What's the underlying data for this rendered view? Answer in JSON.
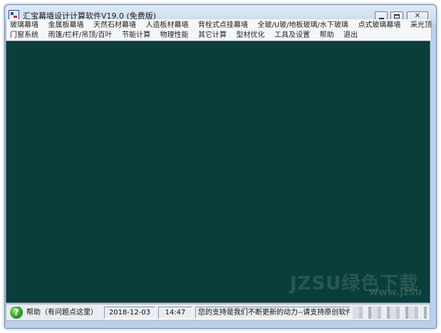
{
  "window": {
    "title": "汇宝幕墙设计计算软件V19.0 (免费版)"
  },
  "menu": {
    "row1": [
      "玻璃幕墙",
      "金属板幕墙",
      "天然石材幕墙",
      "人造板材幕墙",
      "背栓式点挂幕墙",
      "全玻/U玻/地板玻璃/水下玻璃",
      "点式玻璃幕墙",
      "采光顶"
    ],
    "row2": [
      "门窗系统",
      "雨篷/栏杆/吊顶/百叶",
      "节能计算",
      "物理性能",
      "其它计算",
      "型材优化",
      "工具及设置",
      "帮助",
      "退出"
    ]
  },
  "statusbar": {
    "help_icon": "?",
    "help_label": "帮助（有问题点这里）",
    "date": "2018-12-03",
    "time": "14:47",
    "message": "您的支持是我们不断更新的动力--请支持原创软件"
  },
  "watermark": {
    "line1": "JZSU绿色下载",
    "line2": "www.jzsu"
  },
  "colors": {
    "client_bg": "#0a3e3a",
    "menubar_bg": "#f5f6f8",
    "help_icon": "#2a9a1e"
  }
}
